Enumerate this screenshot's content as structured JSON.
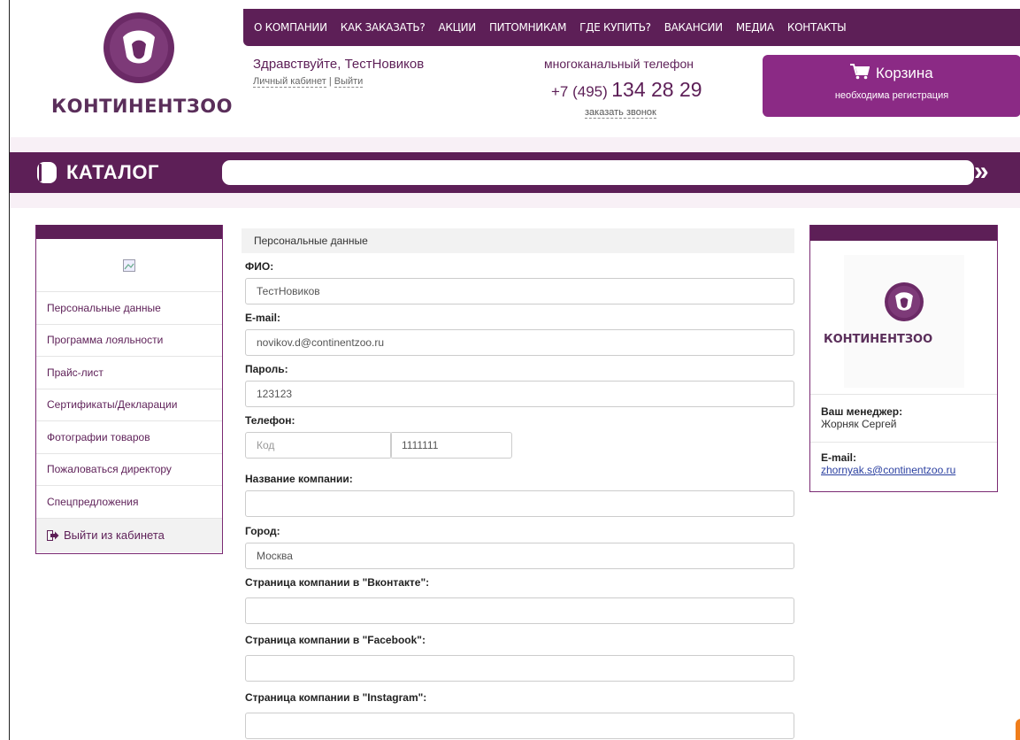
{
  "brand": {
    "name": "КОНТИНЕНТЗОО",
    "accent": "#5d1f57",
    "cart_color": "#8b2a85"
  },
  "topnav": [
    "О КОМПАНИИ",
    "КАК ЗАКАЗАТЬ?",
    "АКЦИИ",
    "ПИТОМНИКАМ",
    "ГДЕ КУПИТЬ?",
    "ВАКАНСИИ",
    "МЕДИА",
    "КОНТАКТЫ"
  ],
  "user": {
    "greeting": "Здравствуйте, ТестНовиков",
    "cabinet": "Личный кабинет",
    "sep": "|",
    "logout": "Выйти"
  },
  "phone": {
    "label": "многоканальный телефон",
    "prefix": "+7 (495)",
    "number": "134 28 29",
    "callback": "заказать звонок"
  },
  "cart": {
    "title": "Корзина",
    "subtitle": "необходима регистрация",
    "icon": "cart-icon"
  },
  "catalog": {
    "title": "КАТАЛОГ",
    "search_value": "",
    "go": "»"
  },
  "sidebar": {
    "items": [
      {
        "label": "Персональные данные"
      },
      {
        "label": "Программа лояльности"
      },
      {
        "label": "Прайс-лист"
      },
      {
        "label": "Сертификаты/Декларации"
      },
      {
        "label": "Фотографии товаров"
      },
      {
        "label": "Пожаловаться директору"
      },
      {
        "label": "Спецпредложения"
      }
    ],
    "exit": "Выйти из кабинета"
  },
  "form": {
    "section": "Персональные данные",
    "fio_label": "ФИО:",
    "fio": "ТестНовиков",
    "email_label": "E-mail:",
    "email": "novikov.d@continentzoo.ru",
    "password_label": "Пароль:",
    "password": "123123",
    "phone_label": "Телефон:",
    "phone_code_placeholder": "Код",
    "phone_number": "1111111",
    "company_label": "Название компании:",
    "company": "",
    "city_label": "Город:",
    "city": "Москва",
    "vk_label": "Страница компании в \"Вконтакте\":",
    "vk": "",
    "fb_label": "Страница компании в \"Facebook\":",
    "fb": "",
    "ig_label": "Страница компании в \"Instagram\":",
    "ig": ""
  },
  "manager": {
    "logo_text": "КОНТИНЕНТЗОО",
    "label": "Ваш менеджер:",
    "name": "Жорняк Сергей",
    "email_label": "E-mail:",
    "email": "zhornyak.s@continentzoo.ru"
  }
}
